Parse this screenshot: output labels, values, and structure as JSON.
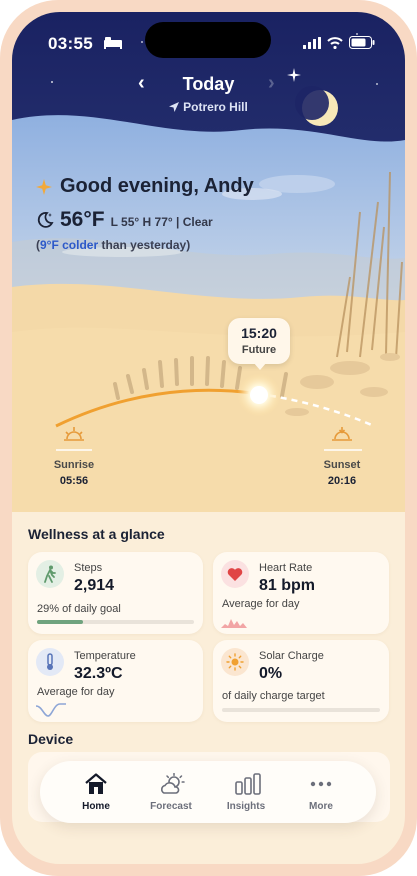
{
  "status_bar": {
    "time": "03:55"
  },
  "header": {
    "title": "Today",
    "location": "Potrero Hill"
  },
  "weather": {
    "greeting": "Good evening, Andy",
    "temperature": "56°F",
    "range": "L 55° H 77° | Clear",
    "comparison_open": "(",
    "comparison_highlight": "9°F colder",
    "comparison_rest": " than yesterday)"
  },
  "sun_path": {
    "current_time": "15:20",
    "current_label": "Future",
    "sunrise_label": "Sunrise",
    "sunrise_time": "05:56",
    "sunset_label": "Sunset",
    "sunset_time": "20:16"
  },
  "wellness": {
    "title": "Wellness at a glance",
    "steps": {
      "label": "Steps",
      "value": "2,914",
      "sub": "29% of daily goal",
      "progress": 0.29
    },
    "heart_rate": {
      "label": "Heart Rate",
      "value": "81 bpm",
      "sub": "Average for day"
    },
    "temperature": {
      "label": "Temperature",
      "value": "32.3ºC",
      "sub": "Average for day"
    },
    "solar_charge": {
      "label": "Solar Charge",
      "value": "0%",
      "sub": "of daily charge target",
      "progress": 0.0
    }
  },
  "device": {
    "title": "Device"
  },
  "tabs": [
    {
      "label": "Home",
      "icon": "home-icon"
    },
    {
      "label": "Forecast",
      "icon": "forecast-icon"
    },
    {
      "label": "Insights",
      "icon": "insights-icon"
    },
    {
      "label": "More",
      "icon": "more-icon"
    }
  ],
  "colors": {
    "accent_blue": "#2d59c9",
    "sun_orange": "#f0a030",
    "steps_green": "#6fa37e",
    "heart_red": "#e04545"
  }
}
